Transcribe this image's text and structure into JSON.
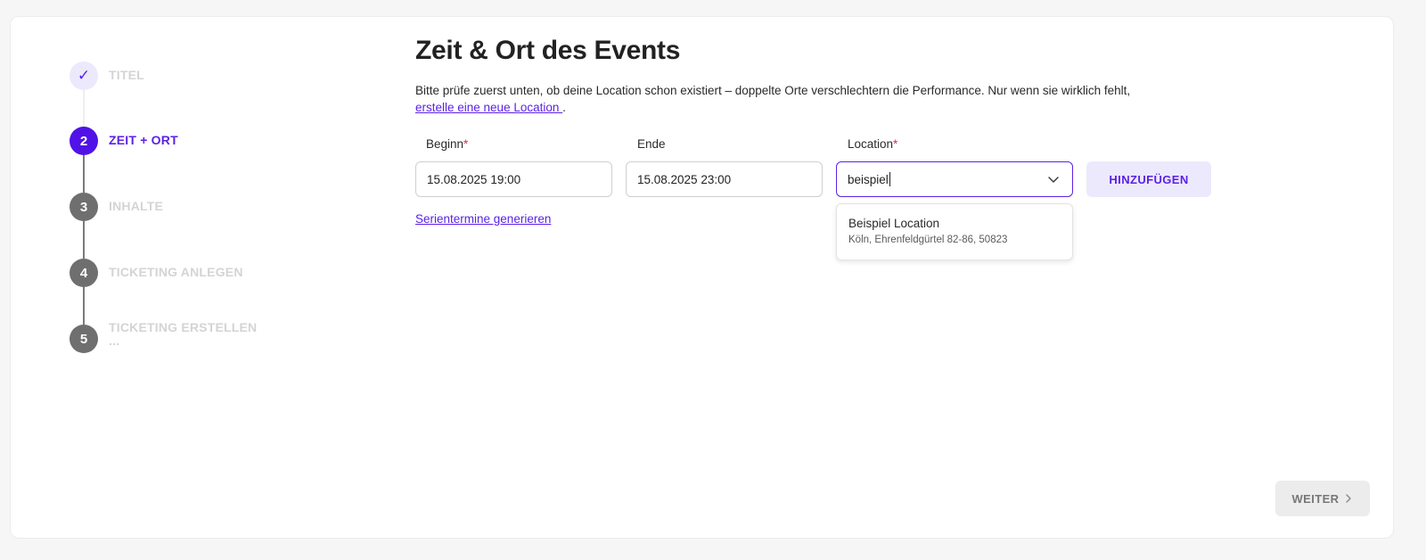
{
  "steps": [
    {
      "number": "✓",
      "label": "TITEL",
      "state": "done"
    },
    {
      "number": "2",
      "label": "ZEIT + ORT",
      "state": "active"
    },
    {
      "number": "3",
      "label": "INHALTE",
      "state": "pending"
    },
    {
      "number": "4",
      "label": "TICKETING ANLEGEN",
      "state": "pending"
    },
    {
      "number": "5",
      "label": "TICKETING ERSTELLEN",
      "sub": "...",
      "state": "pending"
    }
  ],
  "main": {
    "title": "Zeit & Ort des Events",
    "hint_text": "Bitte prüfe zuerst unten, ob deine Location schon existiert – doppelte Orte verschlechtern die Performance. Nur wenn sie wirklich fehlt,",
    "hint_link": "erstelle eine neue Location ",
    "hint_end": "."
  },
  "form": {
    "begin_label": "Beginn",
    "begin_value": "15.08.2025 19:00",
    "end_label": "Ende",
    "end_value": "15.08.2025 23:00",
    "location_label": "Location",
    "location_value": "beispiel",
    "required_mark": "*",
    "add_button": "HINZUFÜGEN",
    "serien_link": "Serientermine generieren"
  },
  "dropdown": {
    "options": [
      {
        "title": "Beispiel Location",
        "subtitle": "Köln, Ehrenfeldgürtel 82-86, 50823"
      }
    ]
  },
  "footer": {
    "next_button": "WEITER"
  },
  "colors": {
    "accent": "#5b21e6",
    "accent_light": "#ece9fc",
    "required": "#d0324b"
  }
}
